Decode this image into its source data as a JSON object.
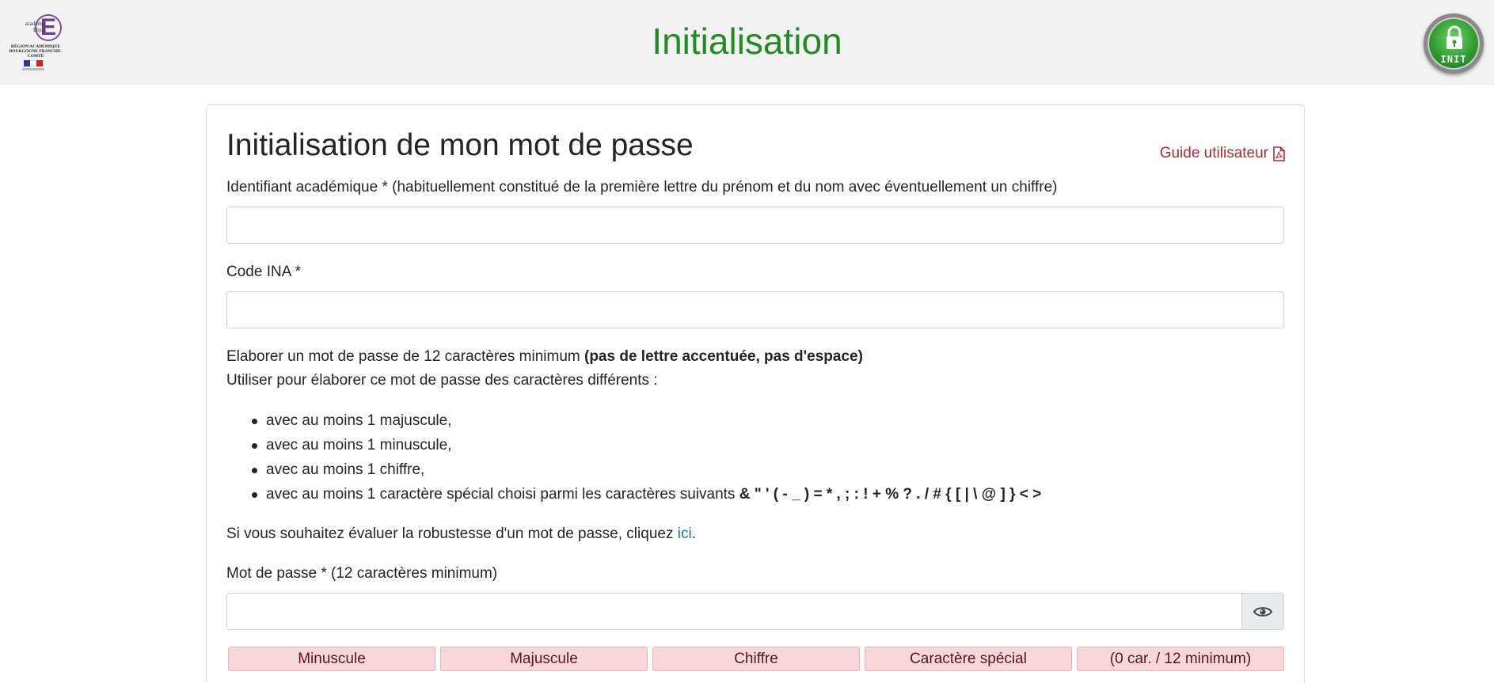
{
  "header": {
    "logo_academie": "académie Dijon",
    "logo_letter": "E",
    "logo_region": "RÉGION ACADÉMIQUE BOURGOGNE FRANCHE-COMTÉ",
    "title": "Initialisation",
    "badge_label": "INIT"
  },
  "form": {
    "title": "Initialisation de mon mot de passe",
    "guide_link": "Guide utilisateur",
    "id_label": "Identifiant académique * (habituellement constitué de la première lettre du prénom et du nom avec éventuellement un chiffre)",
    "id_value": "",
    "ina_label": "Code INA *",
    "ina_value": "",
    "rules_intro_plain": "Elaborer un mot de passe de 12 caractères minimum ",
    "rules_intro_bold": "(pas de lettre accentuée, pas d'espace)",
    "rules_intro_2": "Utiliser pour élaborer ce mot de passe des caractères différents :",
    "rules": [
      "avec au moins 1 majuscule,",
      "avec au moins 1 minuscule,",
      "avec au moins 1 chiffre,",
      "avec au moins 1 caractère spécial choisi parmi les caractères suivants "
    ],
    "special_chars": "& \" ' ( - _ ) = * , ; : ! + % ? . / # { [ | \\ @ ] } < >",
    "robustness_text": "Si vous souhaitez évaluer la robustesse d'un mot de passe, cliquez ",
    "robustness_link": "ici",
    "robustness_end": ".",
    "password_label": "Mot de passe * (12 caractères minimum)",
    "password_value": ""
  },
  "strength": {
    "lowercase": "Minuscule",
    "uppercase": "Majuscule",
    "digit": "Chiffre",
    "special": "Caractère spécial",
    "count": "(0 car. / 12 minimum)"
  },
  "colors": {
    "header_title": "#228b22",
    "link_red": "#b02a37",
    "link_blue": "#1f6fa3",
    "badge_bg": "#f8d7da",
    "badge_text": "#58151c"
  }
}
